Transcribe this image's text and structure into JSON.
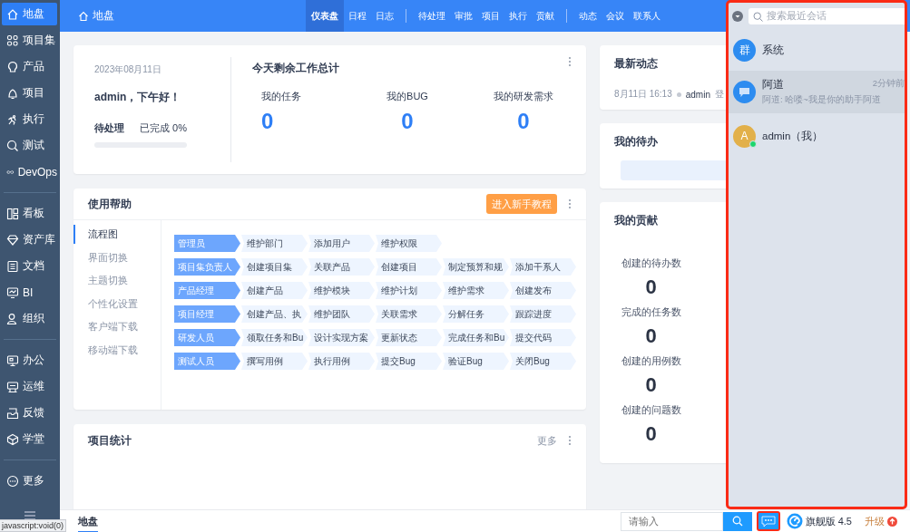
{
  "sidebar": {
    "groups": [
      {
        "items": [
          {
            "label": "地盘",
            "selected": true
          },
          {
            "label": "项目集",
            "selected": false
          },
          {
            "label": "产品",
            "selected": false
          },
          {
            "label": "项目",
            "selected": false
          },
          {
            "label": "执行",
            "selected": false
          },
          {
            "label": "测试",
            "selected": false
          },
          {
            "label": "DevOps",
            "selected": false
          }
        ]
      },
      {
        "items": [
          {
            "label": "看板",
            "selected": false
          },
          {
            "label": "资产库",
            "selected": false
          },
          {
            "label": "文档",
            "selected": false
          },
          {
            "label": "BI",
            "selected": false
          },
          {
            "label": "组织",
            "selected": false
          }
        ]
      },
      {
        "items": [
          {
            "label": "办公",
            "selected": false
          },
          {
            "label": "运维",
            "selected": false
          },
          {
            "label": "反馈",
            "selected": false
          },
          {
            "label": "学堂",
            "selected": false
          }
        ]
      },
      {
        "items": [
          {
            "label": "更多",
            "selected": false
          }
        ]
      }
    ]
  },
  "topbar": {
    "title": "地盘",
    "nav_groups": [
      [
        {
          "label": "仪表盘",
          "selected": true
        },
        {
          "label": "日程",
          "selected": false
        },
        {
          "label": "日志",
          "selected": false
        }
      ],
      [
        {
          "label": "待处理",
          "selected": false
        },
        {
          "label": "审批",
          "selected": false
        },
        {
          "label": "项目",
          "selected": false
        },
        {
          "label": "执行",
          "selected": false
        },
        {
          "label": "贡献",
          "selected": false
        }
      ],
      [
        {
          "label": "动态",
          "selected": false
        },
        {
          "label": "会议",
          "selected": false
        },
        {
          "label": "联系人",
          "selected": false
        }
      ]
    ]
  },
  "welcome": {
    "date": "2023年08月11日",
    "greeting": "admin，下午好！",
    "pending_label": "待处理",
    "done_label": "已完成 0%",
    "level": 0,
    "summary_title": "今天剩余工作总计",
    "stats": [
      {
        "label": "我的任务",
        "value": "0"
      },
      {
        "label": "我的BUG",
        "value": "0"
      },
      {
        "label": "我的研发需求",
        "value": "0"
      }
    ]
  },
  "help": {
    "title": "使用帮助",
    "tutorial_button": "进入新手教程",
    "menu": [
      {
        "label": "流程图",
        "selected": true
      },
      {
        "label": "界面切换",
        "selected": false
      },
      {
        "label": "主题切换",
        "selected": false
      },
      {
        "label": "个性化设置",
        "selected": false
      },
      {
        "label": "客户端下载",
        "selected": false
      },
      {
        "label": "移动端下载",
        "selected": false
      }
    ],
    "flow": [
      {
        "role": "管理员",
        "steps": [
          "维护部门",
          "添加用户",
          "维护权限"
        ]
      },
      {
        "role": "项目集负责人",
        "steps": [
          "创建项目集",
          "关联产品",
          "创建项目",
          "制定预算和规",
          "添加干系人"
        ]
      },
      {
        "role": "产品经理",
        "steps": [
          "创建产品",
          "维护模块",
          "维护计划",
          "维护需求",
          "创建发布"
        ]
      },
      {
        "role": "项目经理",
        "steps": [
          "创建产品、执",
          "维护团队",
          "关联需求",
          "分解任务",
          "跟踪进度"
        ]
      },
      {
        "role": "研发人员",
        "steps": [
          "领取任务和Bu",
          "设计实现方案",
          "更新状态",
          "完成任务和Bu",
          "提交代码"
        ]
      },
      {
        "role": "测试人员",
        "steps": [
          "撰写用例",
          "执行用例",
          "提交Bug",
          "验证Bug",
          "关闭Bug"
        ]
      }
    ]
  },
  "project_stats": {
    "title": "项目统计",
    "more": "更多"
  },
  "activity": {
    "title": "最新动态",
    "entries": [
      {
        "time": "8月11日 16:13",
        "user": "admin",
        "action": "登"
      }
    ]
  },
  "todo": {
    "title": "我的待办"
  },
  "contribution": {
    "title": "我的贡献",
    "items": [
      {
        "label": "创建的待办数",
        "value": "0"
      },
      {
        "label": "完成的任务数",
        "value": "0"
      },
      {
        "label": "创建的用例数",
        "value": "0"
      },
      {
        "label": "创建的问题数",
        "value": "0"
      }
    ]
  },
  "chat": {
    "search_placeholder": "搜索最近会话",
    "conversations": [
      {
        "kind": "group",
        "name": "系统",
        "avatar": "群",
        "selected": false
      },
      {
        "kind": "bot",
        "name": "阿道",
        "time": "2分钟前",
        "preview": "阿道: 哈喽~我是你的助手阿道",
        "selected": true
      },
      {
        "kind": "user",
        "name": "admin（我）",
        "avatar": "A",
        "online": true,
        "selected": false
      }
    ]
  },
  "bottombar": {
    "tab": "地盘",
    "search_placeholder": "请输入",
    "edition": "旗舰版 4.5",
    "upgrade": "升级"
  },
  "status_text": "javascript:void(0)"
}
